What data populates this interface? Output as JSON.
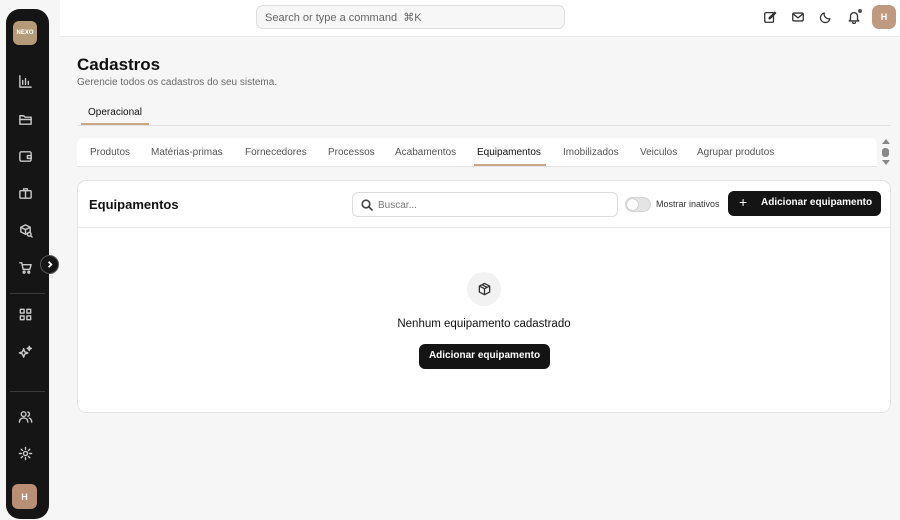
{
  "sidebar": {
    "logo_text": "NEXO",
    "items": [
      {
        "icon": "chart-icon"
      },
      {
        "icon": "folder-icon"
      },
      {
        "icon": "wallet-icon"
      },
      {
        "icon": "briefcase-icon"
      },
      {
        "icon": "box-search-icon"
      },
      {
        "icon": "cart-icon"
      },
      {
        "icon": "grid-icon"
      },
      {
        "icon": "sparkles-icon"
      },
      {
        "icon": "users-icon"
      },
      {
        "icon": "gear-icon"
      }
    ],
    "avatar_initial": "H"
  },
  "topbar": {
    "search_placeholder": "Search or type a command",
    "search_shortcut": "⌘K",
    "icons": [
      "edit-icon",
      "mail-icon",
      "moon-icon",
      "bell-icon"
    ],
    "avatar_initial": "H"
  },
  "header": {
    "title": "Cadastros",
    "subtitle": "Gerencie todos os cadastros do seu sistema.",
    "section_tab": "Operacional"
  },
  "category_tabs": [
    "Produtos",
    "Matérias-primas",
    "Fornecedores",
    "Processos",
    "Acabamentos",
    "Equipamentos",
    "Imobilizados",
    "Veiculos",
    "Agrupar produtos"
  ],
  "active_tab": "Equipamentos",
  "card": {
    "title": "Equipamentos",
    "search_placeholder": "Buscar...",
    "toggle_label": "Mostrar inativos",
    "toggle_on": false,
    "add_button": "Adicionar equipamento",
    "empty_text": "Nenhum equipamento cadastrado",
    "empty_button": "Adicionar equipamento"
  },
  "colors": {
    "accent": "#c8a888",
    "sidebar_bg": "#151515",
    "primary_button": "#141414"
  }
}
